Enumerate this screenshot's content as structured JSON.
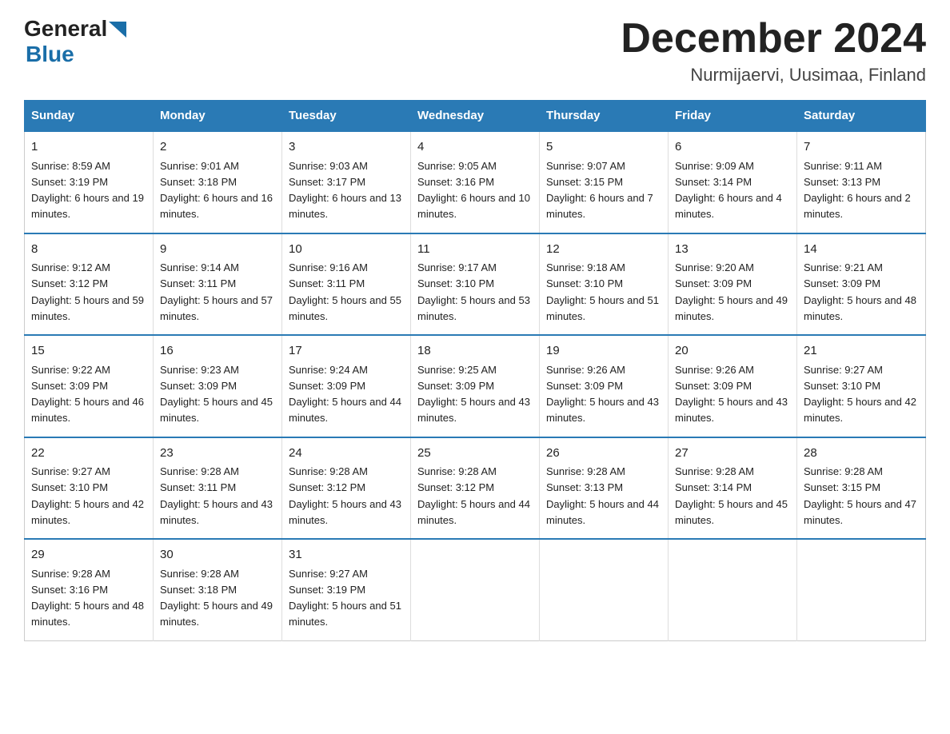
{
  "header": {
    "logo_general": "General",
    "logo_blue": "Blue",
    "title": "December 2024",
    "subtitle": "Nurmijaervi, Uusimaa, Finland"
  },
  "days_of_week": [
    "Sunday",
    "Monday",
    "Tuesday",
    "Wednesday",
    "Thursday",
    "Friday",
    "Saturday"
  ],
  "weeks": [
    [
      {
        "day": "1",
        "sunrise": "8:59 AM",
        "sunset": "3:19 PM",
        "daylight": "6 hours and 19 minutes."
      },
      {
        "day": "2",
        "sunrise": "9:01 AM",
        "sunset": "3:18 PM",
        "daylight": "6 hours and 16 minutes."
      },
      {
        "day": "3",
        "sunrise": "9:03 AM",
        "sunset": "3:17 PM",
        "daylight": "6 hours and 13 minutes."
      },
      {
        "day": "4",
        "sunrise": "9:05 AM",
        "sunset": "3:16 PM",
        "daylight": "6 hours and 10 minutes."
      },
      {
        "day": "5",
        "sunrise": "9:07 AM",
        "sunset": "3:15 PM",
        "daylight": "6 hours and 7 minutes."
      },
      {
        "day": "6",
        "sunrise": "9:09 AM",
        "sunset": "3:14 PM",
        "daylight": "6 hours and 4 minutes."
      },
      {
        "day": "7",
        "sunrise": "9:11 AM",
        "sunset": "3:13 PM",
        "daylight": "6 hours and 2 minutes."
      }
    ],
    [
      {
        "day": "8",
        "sunrise": "9:12 AM",
        "sunset": "3:12 PM",
        "daylight": "5 hours and 59 minutes."
      },
      {
        "day": "9",
        "sunrise": "9:14 AM",
        "sunset": "3:11 PM",
        "daylight": "5 hours and 57 minutes."
      },
      {
        "day": "10",
        "sunrise": "9:16 AM",
        "sunset": "3:11 PM",
        "daylight": "5 hours and 55 minutes."
      },
      {
        "day": "11",
        "sunrise": "9:17 AM",
        "sunset": "3:10 PM",
        "daylight": "5 hours and 53 minutes."
      },
      {
        "day": "12",
        "sunrise": "9:18 AM",
        "sunset": "3:10 PM",
        "daylight": "5 hours and 51 minutes."
      },
      {
        "day": "13",
        "sunrise": "9:20 AM",
        "sunset": "3:09 PM",
        "daylight": "5 hours and 49 minutes."
      },
      {
        "day": "14",
        "sunrise": "9:21 AM",
        "sunset": "3:09 PM",
        "daylight": "5 hours and 48 minutes."
      }
    ],
    [
      {
        "day": "15",
        "sunrise": "9:22 AM",
        "sunset": "3:09 PM",
        "daylight": "5 hours and 46 minutes."
      },
      {
        "day": "16",
        "sunrise": "9:23 AM",
        "sunset": "3:09 PM",
        "daylight": "5 hours and 45 minutes."
      },
      {
        "day": "17",
        "sunrise": "9:24 AM",
        "sunset": "3:09 PM",
        "daylight": "5 hours and 44 minutes."
      },
      {
        "day": "18",
        "sunrise": "9:25 AM",
        "sunset": "3:09 PM",
        "daylight": "5 hours and 43 minutes."
      },
      {
        "day": "19",
        "sunrise": "9:26 AM",
        "sunset": "3:09 PM",
        "daylight": "5 hours and 43 minutes."
      },
      {
        "day": "20",
        "sunrise": "9:26 AM",
        "sunset": "3:09 PM",
        "daylight": "5 hours and 43 minutes."
      },
      {
        "day": "21",
        "sunrise": "9:27 AM",
        "sunset": "3:10 PM",
        "daylight": "5 hours and 42 minutes."
      }
    ],
    [
      {
        "day": "22",
        "sunrise": "9:27 AM",
        "sunset": "3:10 PM",
        "daylight": "5 hours and 42 minutes."
      },
      {
        "day": "23",
        "sunrise": "9:28 AM",
        "sunset": "3:11 PM",
        "daylight": "5 hours and 43 minutes."
      },
      {
        "day": "24",
        "sunrise": "9:28 AM",
        "sunset": "3:12 PM",
        "daylight": "5 hours and 43 minutes."
      },
      {
        "day": "25",
        "sunrise": "9:28 AM",
        "sunset": "3:12 PM",
        "daylight": "5 hours and 44 minutes."
      },
      {
        "day": "26",
        "sunrise": "9:28 AM",
        "sunset": "3:13 PM",
        "daylight": "5 hours and 44 minutes."
      },
      {
        "day": "27",
        "sunrise": "9:28 AM",
        "sunset": "3:14 PM",
        "daylight": "5 hours and 45 minutes."
      },
      {
        "day": "28",
        "sunrise": "9:28 AM",
        "sunset": "3:15 PM",
        "daylight": "5 hours and 47 minutes."
      }
    ],
    [
      {
        "day": "29",
        "sunrise": "9:28 AM",
        "sunset": "3:16 PM",
        "daylight": "5 hours and 48 minutes."
      },
      {
        "day": "30",
        "sunrise": "9:28 AM",
        "sunset": "3:18 PM",
        "daylight": "5 hours and 49 minutes."
      },
      {
        "day": "31",
        "sunrise": "9:27 AM",
        "sunset": "3:19 PM",
        "daylight": "5 hours and 51 minutes."
      },
      null,
      null,
      null,
      null
    ]
  ]
}
